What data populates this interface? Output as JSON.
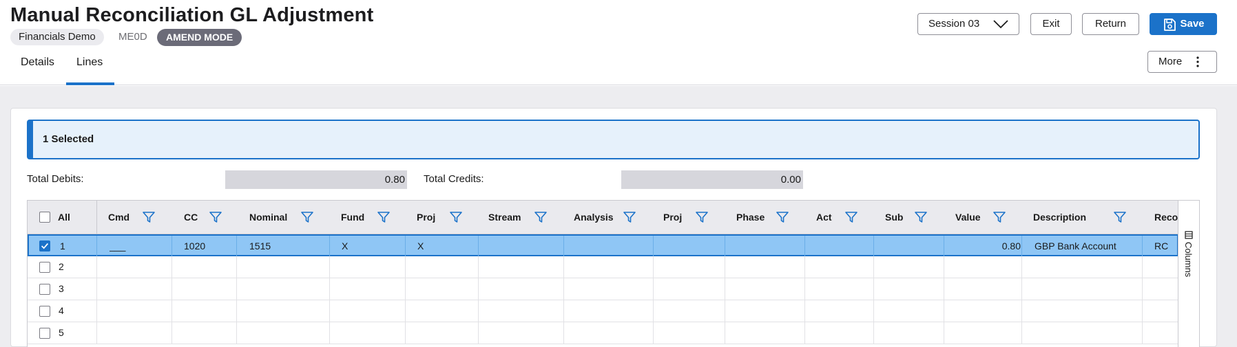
{
  "header": {
    "title": "Manual Reconciliation GL Adjustment",
    "company": "Financials Demo",
    "code": "ME0D",
    "mode": "AMEND MODE"
  },
  "toolbar": {
    "session_label": "Session 03",
    "exit_label": "Exit",
    "return_label": "Return",
    "save_label": "Save",
    "more_label": "More"
  },
  "tabs": [
    {
      "label": "Details",
      "active": false
    },
    {
      "label": "Lines",
      "active": true
    }
  ],
  "selection": {
    "text": "1 Selected"
  },
  "totals": {
    "debits_label": "Total Debits:",
    "debits_value": "0.80",
    "credits_label": "Total Credits:",
    "credits_value": "0.00"
  },
  "grid": {
    "all_label": "All",
    "columns": [
      "Cmd",
      "CC",
      "Nominal",
      "Fund",
      "Proj",
      "Stream",
      "Analysis",
      "Proj",
      "Phase",
      "Act",
      "Sub",
      "Value",
      "Description",
      "Recor"
    ],
    "rows": [
      {
        "num": "1",
        "checked": true,
        "cmd": "___",
        "cc": "1020",
        "nominal": "1515",
        "fund": "X",
        "proj": "X",
        "stream": "",
        "analysis": "",
        "proj2": "",
        "phase": "",
        "act": "",
        "sub": "",
        "value": "0.80",
        "description": "GBP Bank Account",
        "recon": "RC"
      },
      {
        "num": "2",
        "checked": false
      },
      {
        "num": "3",
        "checked": false
      },
      {
        "num": "4",
        "checked": false
      },
      {
        "num": "5",
        "checked": false
      }
    ],
    "columns_rail_label": "Columns"
  },
  "colors": {
    "accent": "#1b72c9",
    "selected_row": "#8fc6f5",
    "banner_bg": "#e6f1fb",
    "mode_badge": "#6b6b78"
  }
}
